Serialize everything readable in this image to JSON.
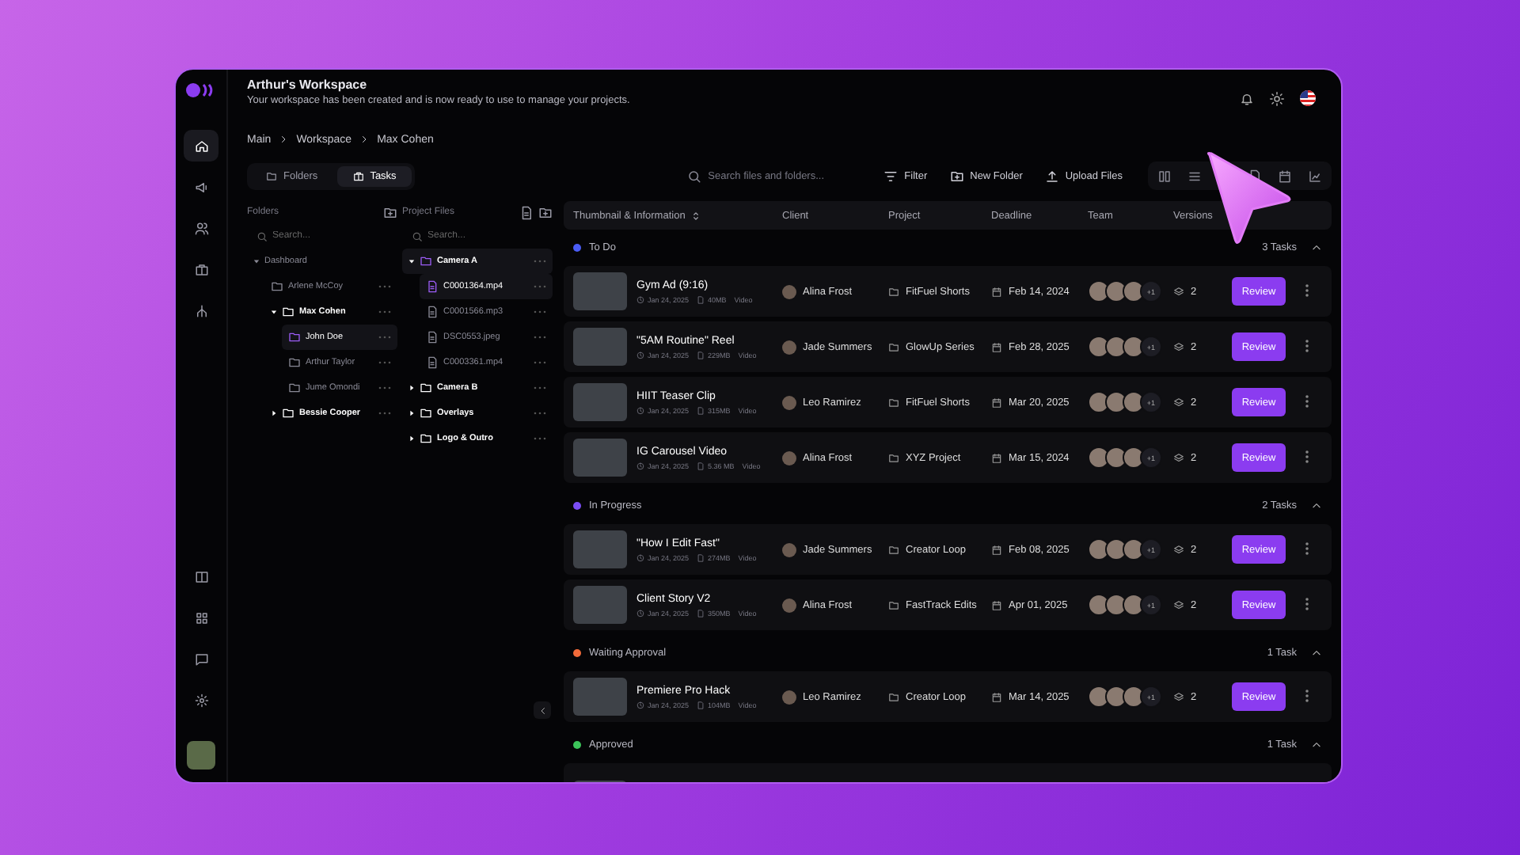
{
  "workspace": {
    "title": "Arthur's Workspace",
    "subtitle": "Your workspace has been created and is now ready to use to manage your projects."
  },
  "breadcrumb": [
    "Main",
    "Workspace",
    "Max Cohen"
  ],
  "view_tabs": [
    {
      "label": "Folders",
      "selected": false
    },
    {
      "label": "Tasks",
      "selected": true
    }
  ],
  "search": {
    "placeholder": "Search files and folders..."
  },
  "toolbar_buttons": [
    {
      "label": "Filter",
      "kind": "filter"
    },
    {
      "label": "New Folder",
      "kind": "folder"
    },
    {
      "label": "Upload Files",
      "kind": "upload"
    }
  ],
  "folders_panel": {
    "title": "Folders",
    "search_placeholder": "Search...",
    "tree": [
      {
        "label": "Dashboard",
        "kind": "root",
        "expanded": true,
        "selected": false,
        "children": [
          {
            "label": "Arlene McCoy",
            "kind": "folder",
            "selected": false
          },
          {
            "label": "Max Cohen",
            "kind": "folder",
            "expanded": true,
            "selected": false,
            "children": [
              {
                "label": "John Doe",
                "kind": "folder",
                "selected": true
              },
              {
                "label": "Arthur Taylor",
                "kind": "folder",
                "selected": false
              },
              {
                "label": "Jume Omondi",
                "kind": "folder",
                "selected": false
              }
            ]
          },
          {
            "label": "Bessie Cooper",
            "kind": "folder",
            "expanded": false,
            "selected": false
          }
        ]
      }
    ]
  },
  "files_panel": {
    "title": "Project Files",
    "search_placeholder": "Search...",
    "tree": [
      {
        "label": "Camera A",
        "kind": "folder",
        "expanded": true,
        "selected": true,
        "children": [
          {
            "label": "C0001364.mp4",
            "kind": "file",
            "selected": true
          },
          {
            "label": "C0001566.mp3",
            "kind": "file",
            "selected": false
          },
          {
            "label": "DSC0553.jpeg",
            "kind": "file",
            "selected": false
          },
          {
            "label": "C0003361.mp4",
            "kind": "file",
            "selected": false
          }
        ]
      },
      {
        "label": "Camera B",
        "kind": "folder",
        "expanded": false,
        "selected": false
      },
      {
        "label": "Overlays",
        "kind": "folder",
        "expanded": false,
        "selected": false
      },
      {
        "label": "Logo & Outro",
        "kind": "folder",
        "expanded": false,
        "selected": false
      }
    ]
  },
  "table": {
    "columns": [
      "Thumbnail & Information",
      "Client",
      "Project",
      "Deadline",
      "Team",
      "Versions"
    ],
    "groups": [
      {
        "name": "To Do",
        "color": "#4a5cf5",
        "count": "3 Tasks",
        "expanded": true,
        "rows": [
          {
            "title": "Gym Ad (9:16)",
            "date": "Jan 24, 2025",
            "size": "40MB",
            "type": "Video",
            "client": "Alina Frost",
            "project": "FitFuel Shorts",
            "deadline": "Feb 14, 2024",
            "extra_members": "+1",
            "versions": "2",
            "action": "Review"
          },
          {
            "title": "\"5AM Routine\" Reel",
            "date": "Jan 24, 2025",
            "size": "229MB",
            "type": "Video",
            "client": "Jade Summers",
            "project": "GlowUp Series",
            "deadline": "Feb 28, 2025",
            "extra_members": "+1",
            "versions": "2",
            "action": "Review"
          },
          {
            "title": "HIIT Teaser Clip",
            "date": "Jan 24, 2025",
            "size": "315MB",
            "type": "Video",
            "client": "Leo Ramirez",
            "project": "FitFuel Shorts",
            "deadline": "Mar 20, 2025",
            "extra_members": "+1",
            "versions": "2",
            "action": "Review"
          },
          {
            "title": "IG Carousel Video",
            "date": "Jan 24, 2025",
            "size": "5.36 MB",
            "type": "Video",
            "client": "Alina Frost",
            "project": "XYZ Project",
            "deadline": "Mar 15, 2024",
            "extra_members": "+1",
            "versions": "2",
            "action": "Review"
          }
        ]
      },
      {
        "name": "In Progress",
        "color": "#7b4df5",
        "count": "2 Tasks",
        "expanded": true,
        "rows": [
          {
            "title": "\"How I Edit Fast\"",
            "date": "Jan 24, 2025",
            "size": "274MB",
            "type": "Video",
            "client": "Jade Summers",
            "project": "Creator Loop",
            "deadline": "Feb 08, 2025",
            "extra_members": "+1",
            "versions": "2",
            "action": "Review"
          },
          {
            "title": "Client Story V2",
            "date": "Jan 24, 2025",
            "size": "350MB",
            "type": "Video",
            "client": "Alina Frost",
            "project": "FastTrack Edits",
            "deadline": "Apr 01, 2025",
            "extra_members": "+1",
            "versions": "2",
            "action": "Review"
          }
        ]
      },
      {
        "name": "Waiting Approval",
        "color": "#f26b3a",
        "count": "1 Task",
        "expanded": true,
        "rows": [
          {
            "title": "Premiere Pro Hack",
            "date": "Jan 24, 2025",
            "size": "104MB",
            "type": "Video",
            "client": "Leo Ramirez",
            "project": "Creator Loop",
            "deadline": "Mar 14, 2025",
            "extra_members": "+1",
            "versions": "2",
            "action": "Review"
          }
        ]
      },
      {
        "name": "Approved",
        "color": "#3cc45a",
        "count": "1 Task",
        "expanded": true
      }
    ]
  }
}
